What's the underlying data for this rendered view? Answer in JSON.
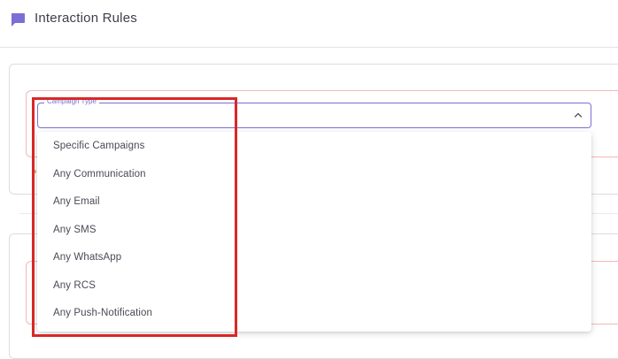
{
  "header": {
    "title": "Interaction Rules",
    "icon": "chat-bubble-icon",
    "icon_color": "#7b6fd6"
  },
  "campaign_select": {
    "label": "Campaign Type",
    "value": "",
    "accent_color": "#7b6fd6",
    "expanded": true
  },
  "dropdown": {
    "options": [
      "Specific Campaigns",
      "Any Communication",
      "Any Email",
      "Any SMS",
      "Any WhatsApp",
      "Any RCS",
      "Any Push-Notification"
    ]
  },
  "colors": {
    "error_outline": "#f2b8b8",
    "highlight_box": "#d92727"
  }
}
